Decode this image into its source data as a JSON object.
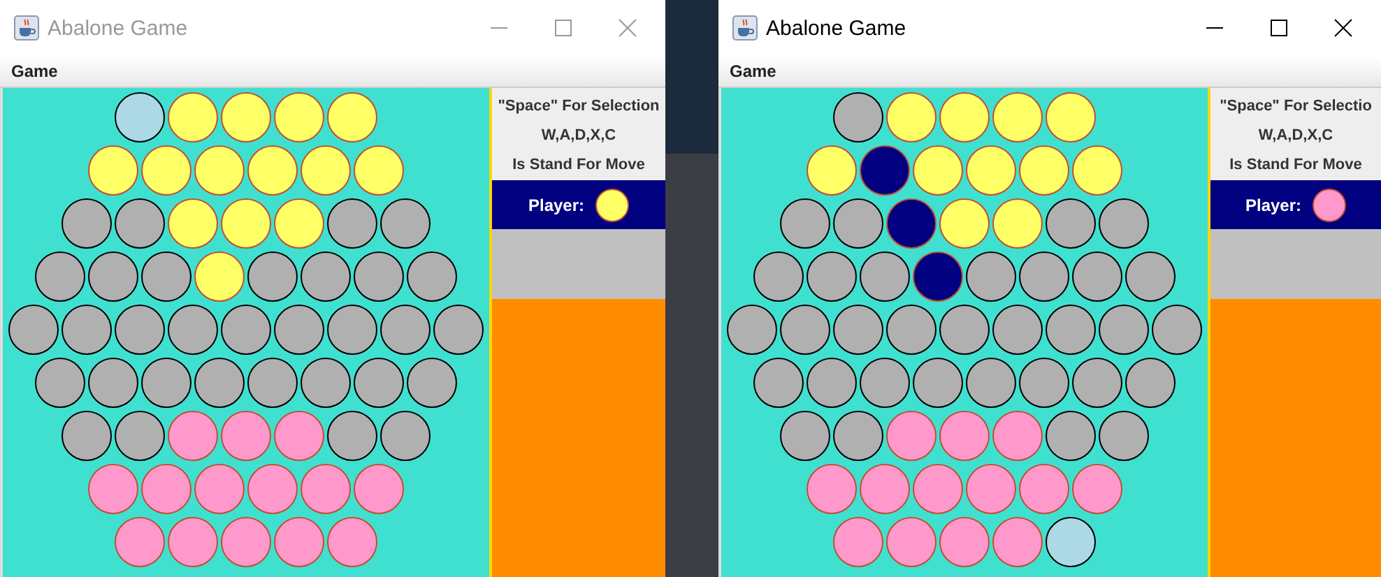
{
  "windows": [
    {
      "title": "Abalone Game",
      "active": false,
      "menu": [
        "Game"
      ],
      "instructions": [
        "\"Space\" For Selection",
        "W,A,D,X,C",
        "Is Stand For Move"
      ],
      "player_label": "Player:",
      "player": {
        "color": "#ffff66"
      },
      "board": [
        [
          {
            "kind": "hole",
            "color": "#add8e6"
          },
          {
            "kind": "marble",
            "color": "#ffff66"
          },
          {
            "kind": "marble",
            "color": "#ffff66"
          },
          {
            "kind": "marble",
            "color": "#ffff66"
          },
          {
            "kind": "marble",
            "color": "#ffff66"
          }
        ],
        [
          {
            "kind": "marble",
            "color": "#ffff66"
          },
          {
            "kind": "marble",
            "color": "#ffff66"
          },
          {
            "kind": "marble",
            "color": "#ffff66"
          },
          {
            "kind": "marble",
            "color": "#ffff66"
          },
          {
            "kind": "marble",
            "color": "#ffff66"
          },
          {
            "kind": "marble",
            "color": "#ffff66"
          }
        ],
        [
          {
            "kind": "hole",
            "color": "#b0b0b0"
          },
          {
            "kind": "hole",
            "color": "#b0b0b0"
          },
          {
            "kind": "marble",
            "color": "#ffff66"
          },
          {
            "kind": "marble",
            "color": "#ffff66"
          },
          {
            "kind": "marble",
            "color": "#ffff66"
          },
          {
            "kind": "hole",
            "color": "#b0b0b0"
          },
          {
            "kind": "hole",
            "color": "#b0b0b0"
          }
        ],
        [
          {
            "kind": "hole",
            "color": "#b0b0b0"
          },
          {
            "kind": "hole",
            "color": "#b0b0b0"
          },
          {
            "kind": "hole",
            "color": "#b0b0b0"
          },
          {
            "kind": "marble",
            "color": "#ffff66"
          },
          {
            "kind": "hole",
            "color": "#b0b0b0"
          },
          {
            "kind": "hole",
            "color": "#b0b0b0"
          },
          {
            "kind": "hole",
            "color": "#b0b0b0"
          },
          {
            "kind": "hole",
            "color": "#b0b0b0"
          }
        ],
        [
          {
            "kind": "hole",
            "color": "#b0b0b0"
          },
          {
            "kind": "hole",
            "color": "#b0b0b0"
          },
          {
            "kind": "hole",
            "color": "#b0b0b0"
          },
          {
            "kind": "hole",
            "color": "#b0b0b0"
          },
          {
            "kind": "hole",
            "color": "#b0b0b0"
          },
          {
            "kind": "hole",
            "color": "#b0b0b0"
          },
          {
            "kind": "hole",
            "color": "#b0b0b0"
          },
          {
            "kind": "hole",
            "color": "#b0b0b0"
          },
          {
            "kind": "hole",
            "color": "#b0b0b0"
          }
        ],
        [
          {
            "kind": "hole",
            "color": "#b0b0b0"
          },
          {
            "kind": "hole",
            "color": "#b0b0b0"
          },
          {
            "kind": "hole",
            "color": "#b0b0b0"
          },
          {
            "kind": "hole",
            "color": "#b0b0b0"
          },
          {
            "kind": "hole",
            "color": "#b0b0b0"
          },
          {
            "kind": "hole",
            "color": "#b0b0b0"
          },
          {
            "kind": "hole",
            "color": "#b0b0b0"
          },
          {
            "kind": "hole",
            "color": "#b0b0b0"
          }
        ],
        [
          {
            "kind": "hole",
            "color": "#b0b0b0"
          },
          {
            "kind": "hole",
            "color": "#b0b0b0"
          },
          {
            "kind": "marble",
            "color": "#ff99cc"
          },
          {
            "kind": "marble",
            "color": "#ff99cc"
          },
          {
            "kind": "marble",
            "color": "#ff99cc"
          },
          {
            "kind": "hole",
            "color": "#b0b0b0"
          },
          {
            "kind": "hole",
            "color": "#b0b0b0"
          }
        ],
        [
          {
            "kind": "marble",
            "color": "#ff99cc"
          },
          {
            "kind": "marble",
            "color": "#ff99cc"
          },
          {
            "kind": "marble",
            "color": "#ff99cc"
          },
          {
            "kind": "marble",
            "color": "#ff99cc"
          },
          {
            "kind": "marble",
            "color": "#ff99cc"
          },
          {
            "kind": "marble",
            "color": "#ff99cc"
          }
        ],
        [
          {
            "kind": "marble",
            "color": "#ff99cc"
          },
          {
            "kind": "marble",
            "color": "#ff99cc"
          },
          {
            "kind": "marble",
            "color": "#ff99cc"
          },
          {
            "kind": "marble",
            "color": "#ff99cc"
          },
          {
            "kind": "marble",
            "color": "#ff99cc"
          }
        ]
      ]
    },
    {
      "title": "Abalone Game",
      "active": true,
      "menu": [
        "Game"
      ],
      "instructions": [
        "\"Space\" For Selectio",
        "W,A,D,X,C",
        "Is Stand For Move"
      ],
      "player_label": "Player:",
      "player": {
        "color": "#ff99cc"
      },
      "board": [
        [
          {
            "kind": "hole",
            "color": "#b0b0b0"
          },
          {
            "kind": "marble",
            "color": "#ffff66"
          },
          {
            "kind": "marble",
            "color": "#ffff66"
          },
          {
            "kind": "marble",
            "color": "#ffff66"
          },
          {
            "kind": "marble",
            "color": "#ffff66"
          }
        ],
        [
          {
            "kind": "marble",
            "color": "#ffff66"
          },
          {
            "kind": "marble",
            "color": "#000080"
          },
          {
            "kind": "marble",
            "color": "#ffff66"
          },
          {
            "kind": "marble",
            "color": "#ffff66"
          },
          {
            "kind": "marble",
            "color": "#ffff66"
          },
          {
            "kind": "marble",
            "color": "#ffff66"
          }
        ],
        [
          {
            "kind": "hole",
            "color": "#b0b0b0"
          },
          {
            "kind": "hole",
            "color": "#b0b0b0"
          },
          {
            "kind": "marble",
            "color": "#000080"
          },
          {
            "kind": "marble",
            "color": "#ffff66"
          },
          {
            "kind": "marble",
            "color": "#ffff66"
          },
          {
            "kind": "hole",
            "color": "#b0b0b0"
          },
          {
            "kind": "hole",
            "color": "#b0b0b0"
          }
        ],
        [
          {
            "kind": "hole",
            "color": "#b0b0b0"
          },
          {
            "kind": "hole",
            "color": "#b0b0b0"
          },
          {
            "kind": "hole",
            "color": "#b0b0b0"
          },
          {
            "kind": "marble",
            "color": "#000080"
          },
          {
            "kind": "hole",
            "color": "#b0b0b0"
          },
          {
            "kind": "hole",
            "color": "#b0b0b0"
          },
          {
            "kind": "hole",
            "color": "#b0b0b0"
          },
          {
            "kind": "hole",
            "color": "#b0b0b0"
          }
        ],
        [
          {
            "kind": "hole",
            "color": "#b0b0b0"
          },
          {
            "kind": "hole",
            "color": "#b0b0b0"
          },
          {
            "kind": "hole",
            "color": "#b0b0b0"
          },
          {
            "kind": "hole",
            "color": "#b0b0b0"
          },
          {
            "kind": "hole",
            "color": "#b0b0b0"
          },
          {
            "kind": "hole",
            "color": "#b0b0b0"
          },
          {
            "kind": "hole",
            "color": "#b0b0b0"
          },
          {
            "kind": "hole",
            "color": "#b0b0b0"
          },
          {
            "kind": "hole",
            "color": "#b0b0b0"
          }
        ],
        [
          {
            "kind": "hole",
            "color": "#b0b0b0"
          },
          {
            "kind": "hole",
            "color": "#b0b0b0"
          },
          {
            "kind": "hole",
            "color": "#b0b0b0"
          },
          {
            "kind": "hole",
            "color": "#b0b0b0"
          },
          {
            "kind": "hole",
            "color": "#b0b0b0"
          },
          {
            "kind": "hole",
            "color": "#b0b0b0"
          },
          {
            "kind": "hole",
            "color": "#b0b0b0"
          },
          {
            "kind": "hole",
            "color": "#b0b0b0"
          }
        ],
        [
          {
            "kind": "hole",
            "color": "#b0b0b0"
          },
          {
            "kind": "hole",
            "color": "#b0b0b0"
          },
          {
            "kind": "marble",
            "color": "#ff99cc"
          },
          {
            "kind": "marble",
            "color": "#ff99cc"
          },
          {
            "kind": "marble",
            "color": "#ff99cc"
          },
          {
            "kind": "hole",
            "color": "#b0b0b0"
          },
          {
            "kind": "hole",
            "color": "#b0b0b0"
          }
        ],
        [
          {
            "kind": "marble",
            "color": "#ff99cc"
          },
          {
            "kind": "marble",
            "color": "#ff99cc"
          },
          {
            "kind": "marble",
            "color": "#ff99cc"
          },
          {
            "kind": "marble",
            "color": "#ff99cc"
          },
          {
            "kind": "marble",
            "color": "#ff99cc"
          },
          {
            "kind": "marble",
            "color": "#ff99cc"
          }
        ],
        [
          {
            "kind": "marble",
            "color": "#ff99cc"
          },
          {
            "kind": "marble",
            "color": "#ff99cc"
          },
          {
            "kind": "marble",
            "color": "#ff99cc"
          },
          {
            "kind": "marble",
            "color": "#ff99cc"
          },
          {
            "kind": "hole",
            "color": "#add8e6"
          }
        ]
      ]
    }
  ]
}
